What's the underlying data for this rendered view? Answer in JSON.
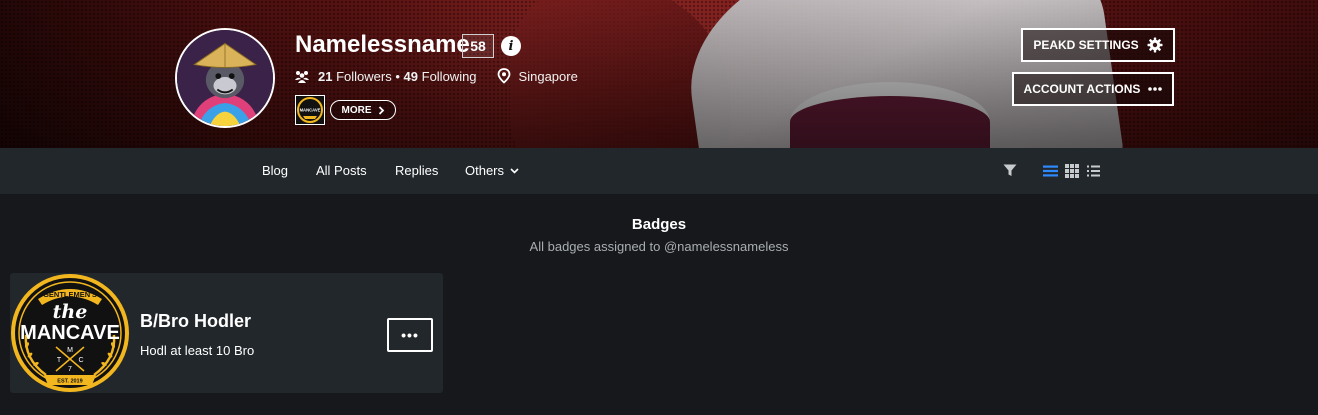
{
  "profile": {
    "username": "Namelessname",
    "reputation": "58",
    "followers_count": "21",
    "followers_label": "Followers",
    "separator": "•",
    "following_count": "49",
    "following_label": "Following",
    "location": "Singapore",
    "more_label": "MORE"
  },
  "header_buttons": {
    "settings_label": "PEAKD SETTINGS",
    "actions_label": "ACCOUNT ACTIONS"
  },
  "nav": {
    "items": [
      {
        "label": "Blog"
      },
      {
        "label": "All Posts"
      },
      {
        "label": "Replies"
      },
      {
        "label": "Others"
      }
    ],
    "active_view": "list",
    "accent_color": "#2e8bff"
  },
  "badges_section": {
    "title": "Badges",
    "subtitle": "All badges assigned to @namelessnameless",
    "cards": [
      {
        "title": "B/Bro Hodler",
        "description": "Hodl at least 10 Bro",
        "menu_label": "•••",
        "badge_text": {
          "top": "GENTLEMEN'S",
          "script": "the",
          "main": "MANCAVE",
          "letters": [
            "M",
            "T",
            "C",
            "7"
          ],
          "est": "EST. 2019"
        }
      }
    ]
  },
  "colors": {
    "background": "#16181b",
    "navbar": "#22272b",
    "card": "#22272b",
    "badge_gold": "#f2b61f"
  }
}
